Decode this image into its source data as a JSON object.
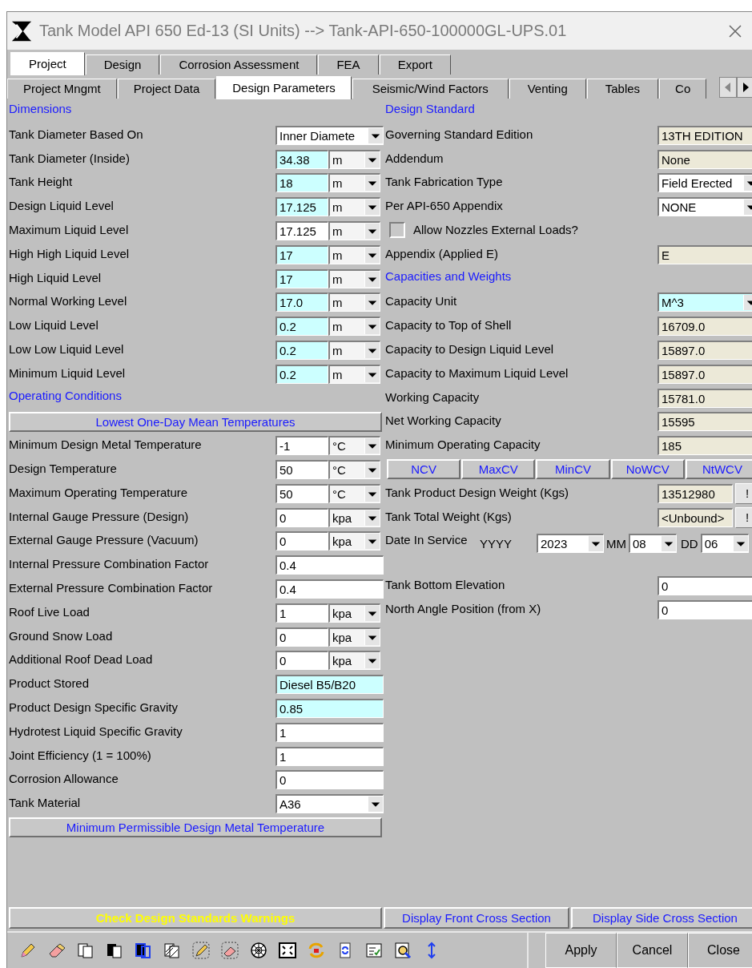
{
  "window": {
    "title": "Tank Model API 650 Ed-13 (SI Units) --> Tank-API-650-100000GL-UPS.01"
  },
  "tabs": [
    {
      "label": "Project",
      "selected": true
    },
    {
      "label": "Design",
      "selected": false
    },
    {
      "label": "Corrosion Assessment",
      "selected": false
    },
    {
      "label": "FEA",
      "selected": false
    },
    {
      "label": "Export",
      "selected": false
    }
  ],
  "subtabs": [
    {
      "label": "Project Mngmt",
      "selected": false
    },
    {
      "label": "Project Data",
      "selected": false
    },
    {
      "label": "Design Parameters",
      "selected": true
    },
    {
      "label": "Seismic/Wind Factors",
      "selected": false
    },
    {
      "label": "Venting",
      "selected": false
    },
    {
      "label": "Tables",
      "selected": false
    },
    {
      "label": "Co",
      "selected": false
    }
  ],
  "left_panel": [
    {
      "kind": "heading",
      "text": "Dimensions"
    },
    {
      "kind": "select",
      "label": "Tank Diameter Based On",
      "value": "Inner Diamete",
      "highlighted": false
    },
    {
      "kind": "unit",
      "label": "Tank Diameter (Inside)",
      "value": "34.38",
      "highlighted": true,
      "unit": "m"
    },
    {
      "kind": "unit",
      "label": "Tank Height",
      "value": "18",
      "highlighted": true,
      "unit": "m"
    },
    {
      "kind": "unit",
      "label": "Design Liquid Level",
      "value": "17.125",
      "highlighted": true,
      "unit": "m"
    },
    {
      "kind": "unit",
      "label": "Maximum Liquid Level",
      "value": "17.125",
      "highlighted": false,
      "unit": "m"
    },
    {
      "kind": "unit",
      "label": "High High Liquid Level",
      "value": "17",
      "highlighted": true,
      "unit": "m"
    },
    {
      "kind": "unit",
      "label": "High Liquid Level",
      "value": "17",
      "highlighted": true,
      "unit": "m"
    },
    {
      "kind": "unit",
      "label": "Normal Working Level",
      "value": "17.0",
      "highlighted": true,
      "unit": "m"
    },
    {
      "kind": "unit",
      "label": "Low Liquid Level",
      "value": "0.2",
      "highlighted": true,
      "unit": "m"
    },
    {
      "kind": "unit",
      "label": "Low Low Liquid Level",
      "value": "0.2",
      "highlighted": true,
      "unit": "m"
    },
    {
      "kind": "unit",
      "label": "Minimum Liquid Level",
      "value": "0.2",
      "highlighted": true,
      "unit": "m"
    },
    {
      "kind": "heading",
      "text": "Operating Conditions"
    },
    {
      "kind": "band",
      "label": "Lowest One-Day Mean Temperatures"
    },
    {
      "kind": "unit",
      "label": "Minimum Design Metal Temperature",
      "value": "-1",
      "highlighted": false,
      "unit": "°C"
    },
    {
      "kind": "unit",
      "label": "Design Temperature",
      "value": "50",
      "highlighted": false,
      "unit": "°C"
    },
    {
      "kind": "unit",
      "label": "Maximum Operating Temperature",
      "value": "50",
      "highlighted": false,
      "unit": "°C"
    },
    {
      "kind": "unit",
      "label": "Internal Gauge Pressure (Design)",
      "value": "0",
      "highlighted": false,
      "unit": "kpa"
    },
    {
      "kind": "unit",
      "label": "External Gauge Pressure (Vacuum)",
      "value": "0",
      "highlighted": false,
      "unit": "kpa"
    },
    {
      "kind": "text",
      "label": "Internal Pressure Combination Factor",
      "value": "0.4",
      "highlighted": false
    },
    {
      "kind": "text",
      "label": "External Pressure Combination Factor",
      "value": "0.4",
      "highlighted": false
    },
    {
      "kind": "unit",
      "label": "Roof Live Load",
      "value": "1",
      "highlighted": false,
      "unit": "kpa"
    },
    {
      "kind": "unit",
      "label": "Ground Snow Load",
      "value": "0",
      "highlighted": false,
      "unit": "kpa"
    },
    {
      "kind": "unit",
      "label": "Additional Roof Dead Load",
      "value": "0",
      "highlighted": false,
      "unit": "kpa"
    },
    {
      "kind": "text",
      "label": "Product Stored",
      "value": "Diesel B5/B20",
      "highlighted": true
    },
    {
      "kind": "text",
      "label": "Product Design Specific Gravity",
      "value": "0.85",
      "highlighted": true
    },
    {
      "kind": "text",
      "label": "Hydrotest Liquid Specific Gravity",
      "value": "1",
      "highlighted": false
    },
    {
      "kind": "text",
      "label": "Joint Efficiency (1 = 100%)",
      "value": "1",
      "highlighted": false
    },
    {
      "kind": "text",
      "label": "Corrosion Allowance",
      "value": "0",
      "highlighted": false
    },
    {
      "kind": "select",
      "label": "Tank Material",
      "value": "A36",
      "highlighted": false
    },
    {
      "kind": "band",
      "label": "Minimum Permissible Design Metal Temperature"
    }
  ],
  "right_panel": [
    {
      "kind": "heading",
      "text": "Design Standard"
    },
    {
      "kind": "readonly",
      "label": "Governing Standard Edition",
      "value": "13TH EDITION"
    },
    {
      "kind": "readonly",
      "label": "Addendum",
      "value": "None"
    },
    {
      "kind": "select",
      "label": "Tank Fabrication Type",
      "value": "Field Erected",
      "highlighted": false
    },
    {
      "kind": "select",
      "label": "Per API-650 Appendix",
      "value": "NONE",
      "highlighted": false
    },
    {
      "kind": "checkbox",
      "label": "Allow Nozzles External Loads?",
      "checked": false
    },
    {
      "kind": "readonly",
      "label": "Appendix (Applied E)",
      "value": "E"
    },
    {
      "kind": "heading",
      "text": "Capacities and Weights"
    },
    {
      "kind": "select",
      "label": "Capacity Unit",
      "value": "M^3",
      "highlighted": true
    },
    {
      "kind": "readonly",
      "label": "Capacity to Top of Shell",
      "value": "16709.0"
    },
    {
      "kind": "readonly",
      "label": "Capacity to Design Liquid Level",
      "value": "15897.0"
    },
    {
      "kind": "readonly",
      "label": "Capacity to Maximum Liquid Level",
      "value": "15897.0"
    },
    {
      "kind": "readonly",
      "label": "Working Capacity",
      "value": "15781.0"
    },
    {
      "kind": "readonly",
      "label": "Net Working Capacity",
      "value": "15595"
    },
    {
      "kind": "readonly",
      "label": "Minimum Operating Capacity",
      "value": "185"
    },
    {
      "kind": "buttons",
      "buttons": [
        "NCV",
        "MaxCV",
        "MinCV",
        "NoWCV",
        "NtWCV"
      ]
    },
    {
      "kind": "weight",
      "label": "Tank Product Design Weight (Kgs)",
      "value": "13512980",
      "action": "!"
    },
    {
      "kind": "weight",
      "label": "Tank Total Weight (Kgs)",
      "value": "<Unbound>",
      "action": "!"
    },
    {
      "kind": "date",
      "label": "Date In Service",
      "year_label": "YYYY",
      "year": "2023",
      "month_label": "MM",
      "month": "08",
      "day_label": "DD",
      "day": "06"
    },
    {
      "kind": "spacer"
    },
    {
      "kind": "text",
      "label": "Tank Bottom Elevation",
      "value": "0",
      "highlighted": false
    },
    {
      "kind": "text",
      "label": "North Angle Position (from X)",
      "value": "0",
      "highlighted": false
    }
  ],
  "bottom_buttons": [
    {
      "label": "Check Design Standards Warnings",
      "kind": "warning"
    },
    {
      "label": "Display Front Cross Section",
      "kind": "link"
    },
    {
      "label": "Display Side Cross Section",
      "kind": "link"
    }
  ],
  "dialog_buttons": [
    "Apply",
    "Cancel",
    "Close"
  ]
}
